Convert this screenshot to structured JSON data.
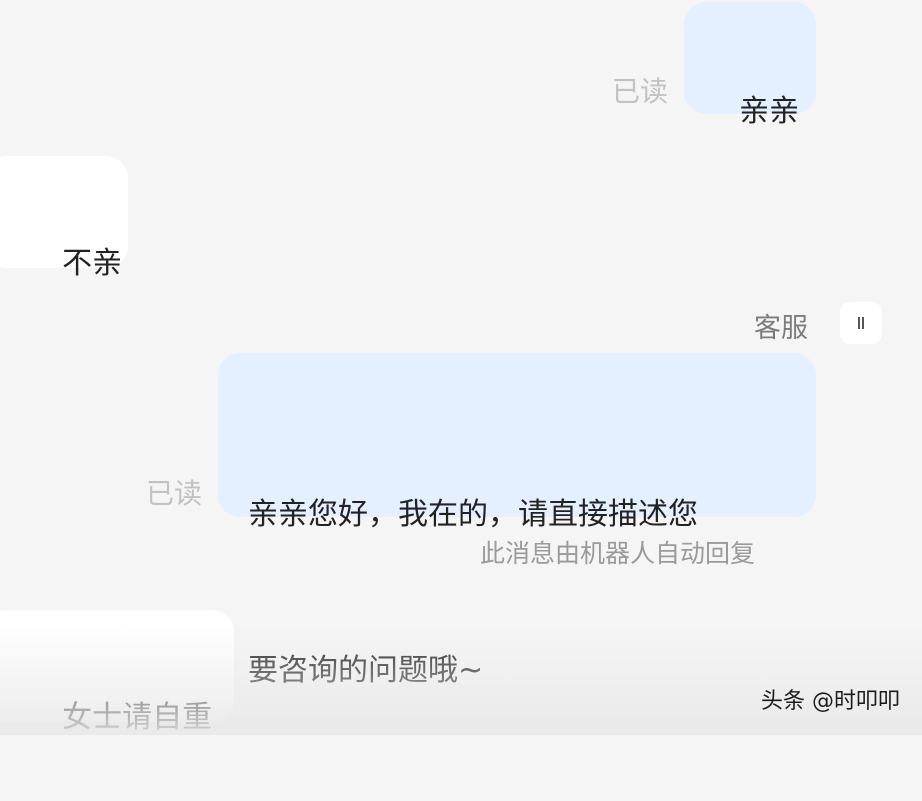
{
  "conversation": {
    "messages": [
      {
        "text": "亲亲",
        "read_status": "已读"
      },
      {
        "text": "不亲"
      },
      {
        "sender": "客服",
        "text_line1": "亲亲您好，我在的，请直接描述您",
        "text_line2": "要咨询的问题哦~",
        "read_status": "已读",
        "note": "此消息由机器人自动回复"
      },
      {
        "text": "女士请自重"
      }
    ]
  },
  "watermark": "头条 @时叩叩",
  "colors": {
    "outgoing_bubble": "#e4f0ff",
    "incoming_bubble": "#ffffff",
    "background": "#f5f5f5",
    "read_status": "#c2c2c2"
  }
}
